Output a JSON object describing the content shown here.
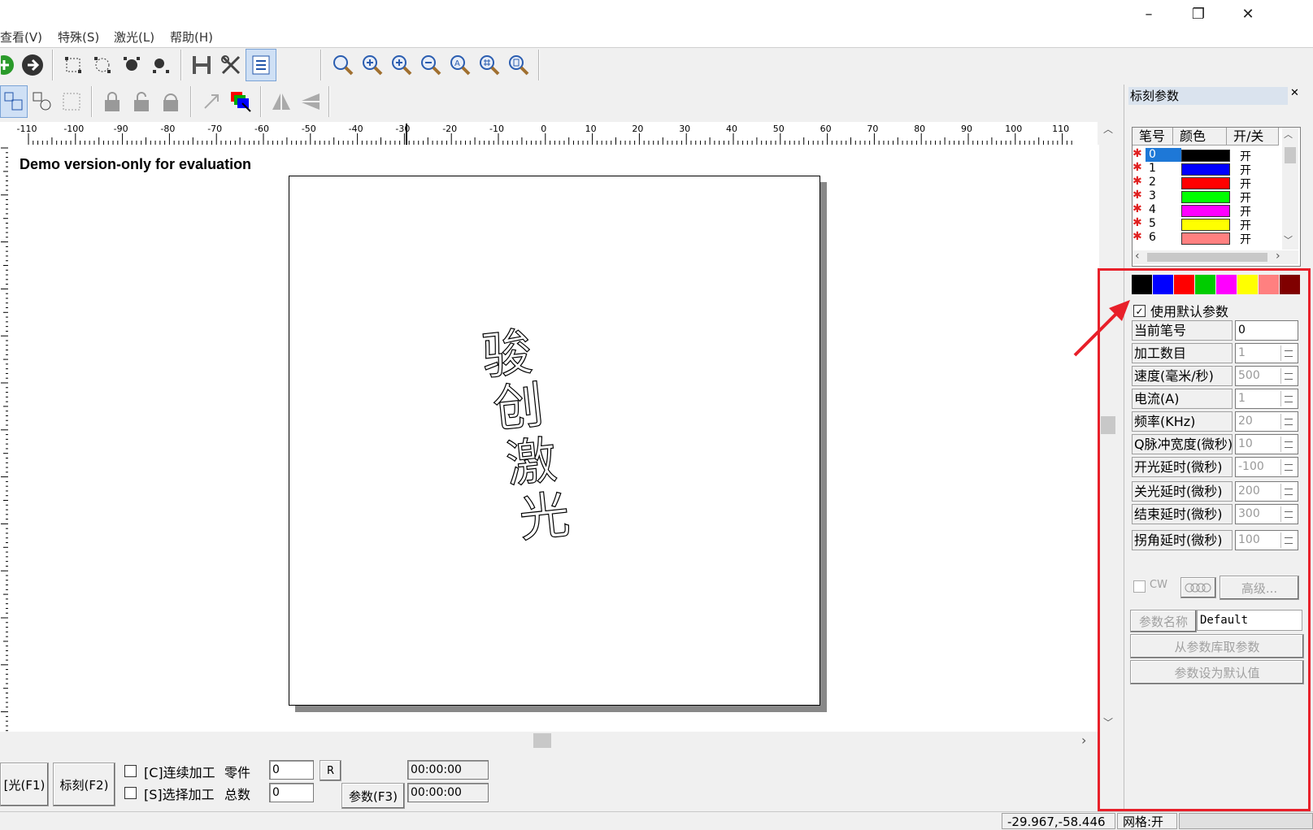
{
  "window": {
    "min": "–",
    "restore": "❐",
    "close": "✕"
  },
  "menu": [
    "查看(V)",
    "特殊(S)",
    "激光(L)",
    "帮助(H)"
  ],
  "ruler_labels": [
    "-110",
    "-100",
    "-90",
    "-80",
    "-70",
    "-60",
    "-50",
    "-40",
    "-30",
    "-20",
    "-10",
    "0",
    "10",
    "20",
    "30",
    "40",
    "50",
    "60",
    "70",
    "80",
    "90",
    "100",
    "110"
  ],
  "canvas": {
    "demo_text": "Demo version-only for evaluation",
    "chars": [
      "骏",
      "创",
      "激",
      "光"
    ]
  },
  "bottom": {
    "red_light_btn": "[光(F1)",
    "mark_btn": "标刻(F2)",
    "continuous": "[C]连续加工",
    "select_process": "[S]选择加工",
    "parts_label": "零件",
    "total_label": "总数",
    "parts_value": "0",
    "total_value": "0",
    "r_btn": "R",
    "params_btn": "参数(F3)",
    "time1": "00:00:00",
    "time2": "00:00:00"
  },
  "status": {
    "coords": "-29.967,-58.446",
    "grid": "网格:开",
    "extra": ""
  },
  "panel": {
    "title": "标刻参数",
    "close": "✕",
    "headers": {
      "pen": "笔号",
      "color": "颜色",
      "onoff": "开/关"
    },
    "pens": [
      {
        "no": "0",
        "color": "#000000",
        "state": "开"
      },
      {
        "no": "1",
        "color": "#0000ff",
        "state": "开"
      },
      {
        "no": "2",
        "color": "#ff0000",
        "state": "开"
      },
      {
        "no": "3",
        "color": "#00ff00",
        "state": "开"
      },
      {
        "no": "4",
        "color": "#ff00ff",
        "state": "开"
      },
      {
        "no": "5",
        "color": "#ffff00",
        "state": "开"
      },
      {
        "no": "6",
        "color": "#ff8080",
        "state": "开"
      }
    ],
    "palette": [
      "#000000",
      "#0000ff",
      "#ff0000",
      "#00cc00",
      "#ff00ff",
      "#ffff00",
      "#ff8080",
      "#800000"
    ],
    "use_default": "使用默认参数",
    "use_default_checked": true,
    "params": [
      {
        "label": "当前笔号",
        "value": "0",
        "spin": false
      },
      {
        "label": "加工数目",
        "value": "1",
        "spin": true
      },
      {
        "label": "速度(毫米/秒)",
        "value": "500",
        "spin": true
      },
      {
        "label": "电流(A)",
        "value": "1",
        "spin": true
      },
      {
        "label": "频率(KHz)",
        "value": "20",
        "spin": true
      },
      {
        "label": "Q脉冲宽度(微秒)",
        "value": "10",
        "spin": true
      },
      {
        "label": "开光延时(微秒)",
        "value": "-100",
        "spin": true
      },
      {
        "label": "关光延时(微秒)",
        "value": "200",
        "spin": true
      },
      {
        "label": "结束延时(微秒)",
        "value": "300",
        "spin": true
      },
      {
        "label": "拐角延时(微秒)",
        "value": "100",
        "spin": true
      }
    ],
    "cw": "CW",
    "advanced": "高级...",
    "param_name_label": "参数名称",
    "param_name_value": "Default",
    "load_from_lib": "从参数库取参数",
    "set_default": "参数设为默认值"
  }
}
